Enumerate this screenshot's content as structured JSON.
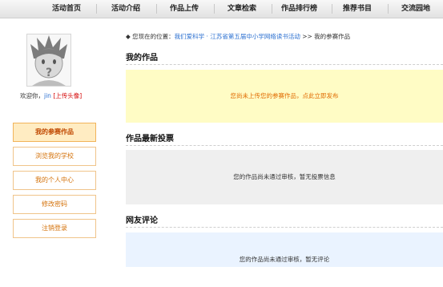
{
  "nav": {
    "items": [
      "活动首页",
      "活动介绍",
      "作品上传",
      "文章检索",
      "作品排行榜",
      "推荐书目",
      "交流园地"
    ]
  },
  "sidebar": {
    "welcome_prefix": "欢迎你，",
    "username": "jin",
    "upload_avatar": "[上传头像]",
    "items": [
      {
        "label": "我的参赛作品"
      },
      {
        "label": "浏览我的学校"
      },
      {
        "label": "我的个人中心"
      },
      {
        "label": "修改密码"
      },
      {
        "label": "注销登录"
      }
    ]
  },
  "breadcrumb": {
    "marker": "◆",
    "prefix": "您现在的位置：",
    "link": "我们爱科学 · 江苏省第五届中小学网络读书活动",
    "sep": " >> ",
    "current": "我的参赛作品"
  },
  "sections": {
    "works": {
      "title": "我的作品",
      "message": "您尚未上传您的参赛作品，点此立即发布"
    },
    "votes": {
      "title": "作品最新投票",
      "message": "您的作品尚未通过审核，暂无投票信息"
    },
    "comments": {
      "title": "网友评论",
      "message": "您的作品尚未通过审核，暂无评论"
    }
  },
  "colors": {
    "accent": "#d4720a",
    "link": "#2a6fd0",
    "notice": "#e06a00"
  }
}
